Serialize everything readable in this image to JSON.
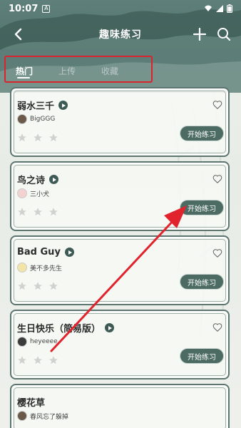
{
  "status_bar": {
    "time": "10:07",
    "badge": "A"
  },
  "header": {
    "title": "趣味练习"
  },
  "tabs": [
    {
      "label": "热门",
      "active": true
    },
    {
      "label": "上传",
      "active": false
    },
    {
      "label": "收藏",
      "active": false
    }
  ],
  "cards": [
    {
      "title": "弱水三千",
      "user": "BigGGG",
      "button": "开始练习",
      "stars": 3
    },
    {
      "title": "鸟之诗",
      "user": "三小犬",
      "button": "开始练习",
      "stars": 3
    },
    {
      "title": "Bad Guy",
      "user": "美不多先生",
      "button": "开始练习",
      "stars": 3
    },
    {
      "title": "生日快乐（简易版）",
      "user": "heyeeee",
      "button": "开始练习",
      "stars": 3
    },
    {
      "title": "樱花草",
      "user": "春风忘了躲掉"
    }
  ],
  "colors": {
    "accent": "#4c6b63",
    "annotation": "#d9232d"
  }
}
